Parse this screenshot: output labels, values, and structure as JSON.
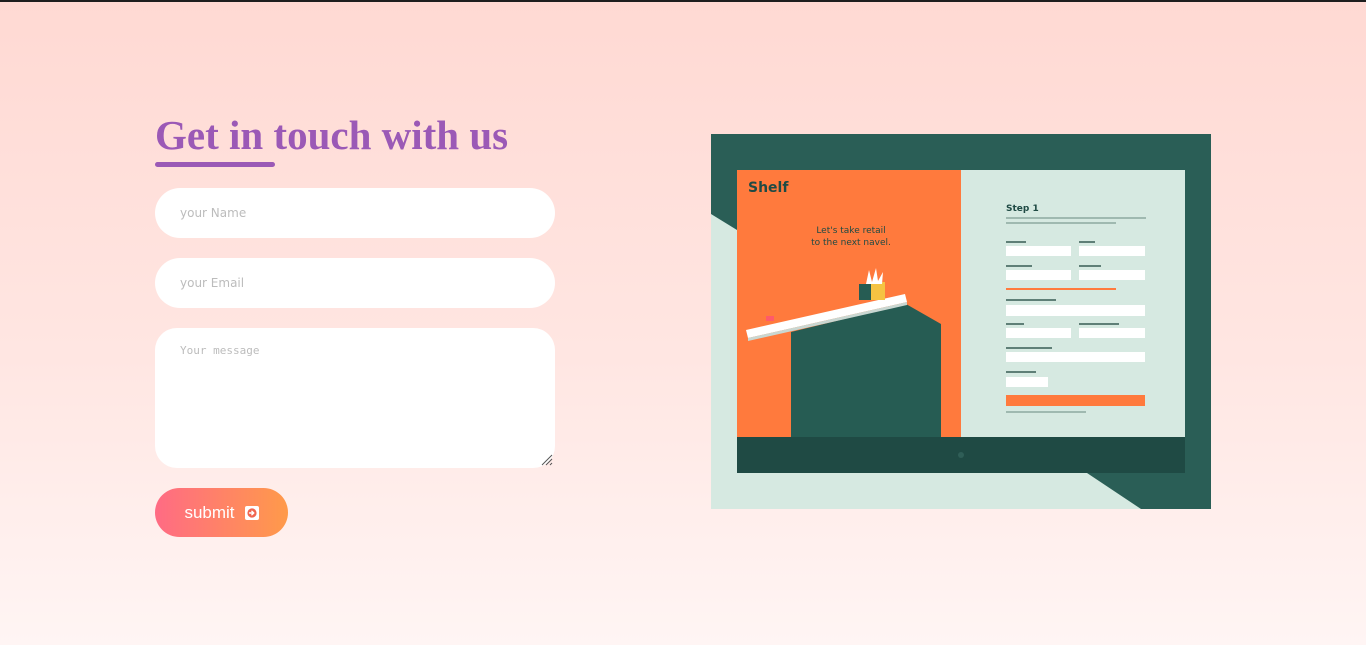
{
  "contact": {
    "title": "Get in touch with us",
    "name_placeholder": "your Name",
    "email_placeholder": "your Email",
    "message_placeholder": "Your message",
    "submit_label": "submit"
  },
  "preview": {
    "brand": "Shelf",
    "headline_line1": "Let's take retail",
    "headline_line2": "to the next navel.",
    "step_title": "Step 1"
  },
  "colors": {
    "accent": "#9b59b6",
    "button_start": "#ff6b84",
    "button_end": "#ff9a4a",
    "preview_dark": "#2a5e56",
    "preview_orange": "#ff7a3d",
    "preview_mint": "#d6e9e1"
  },
  "icons": {
    "submit_icon": "arrow-right-circle-icon",
    "resize_icon": "resize-grip-icon"
  }
}
